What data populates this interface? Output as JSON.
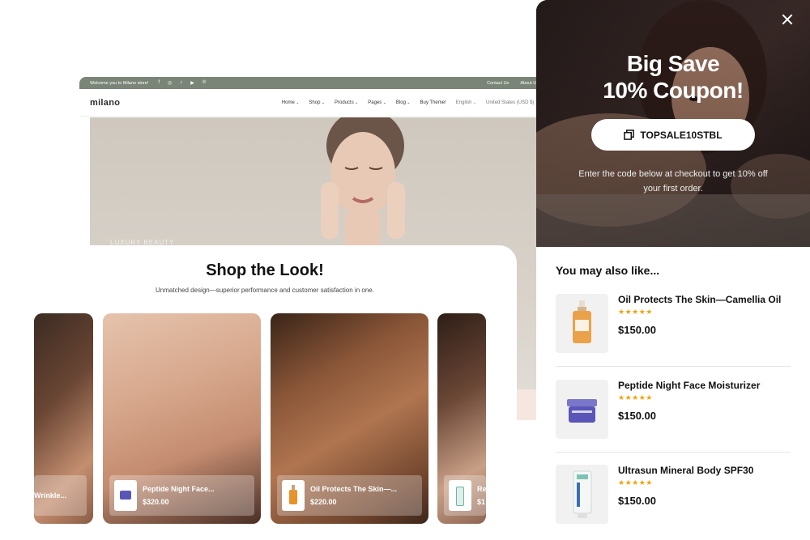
{
  "store": {
    "topbar": {
      "welcome": "Welcome you to Milano store!",
      "social": [
        "f",
        "◎",
        "♪",
        "▶",
        "℗"
      ],
      "contact": "Contact Us",
      "about": "About Us"
    },
    "logo": "milano",
    "menu": [
      "Home",
      "Shop",
      "Products",
      "Pages",
      "Blog"
    ],
    "buy_theme": "Buy Theme!",
    "language": "English",
    "currency": "United States (USD $)",
    "hero_label": "LUXURY BEAUTY"
  },
  "shop_the_look": {
    "title": "Shop the Look!",
    "subtitle": "Unmatched design—superior performance and customer satisfaction in one.",
    "slides": [
      {
        "name": "Wrinkle...",
        "price": ""
      },
      {
        "name": "Peptide Night Face...",
        "price": "$320.00"
      },
      {
        "name": "Oil Protects The Skin—...",
        "price": "$220.00"
      },
      {
        "name": "Re",
        "price": "$1"
      }
    ]
  },
  "popup": {
    "title_line1": "Big Save",
    "title_line2": "10% Coupon!",
    "coupon_code": "TOPSALE10STBL",
    "description": "Enter the code below at checkout to get 10% off your first order.",
    "also_heading": "You may also like...",
    "products": [
      {
        "name": "Oil Protects The Skin—Camellia Oil",
        "rating": 5,
        "price": "$150.00"
      },
      {
        "name": "Peptide Night Face Moisturizer",
        "rating": 5,
        "price": "$150.00"
      },
      {
        "name": "Ultrasun Mineral Body SPF30",
        "rating": 5,
        "price": "$150.00"
      }
    ]
  },
  "colors": {
    "topbar": "#7a8577",
    "stars": "#f2a20c",
    "popup_hero": "#3a2b2a",
    "coupon_bg": "#ffffff"
  }
}
